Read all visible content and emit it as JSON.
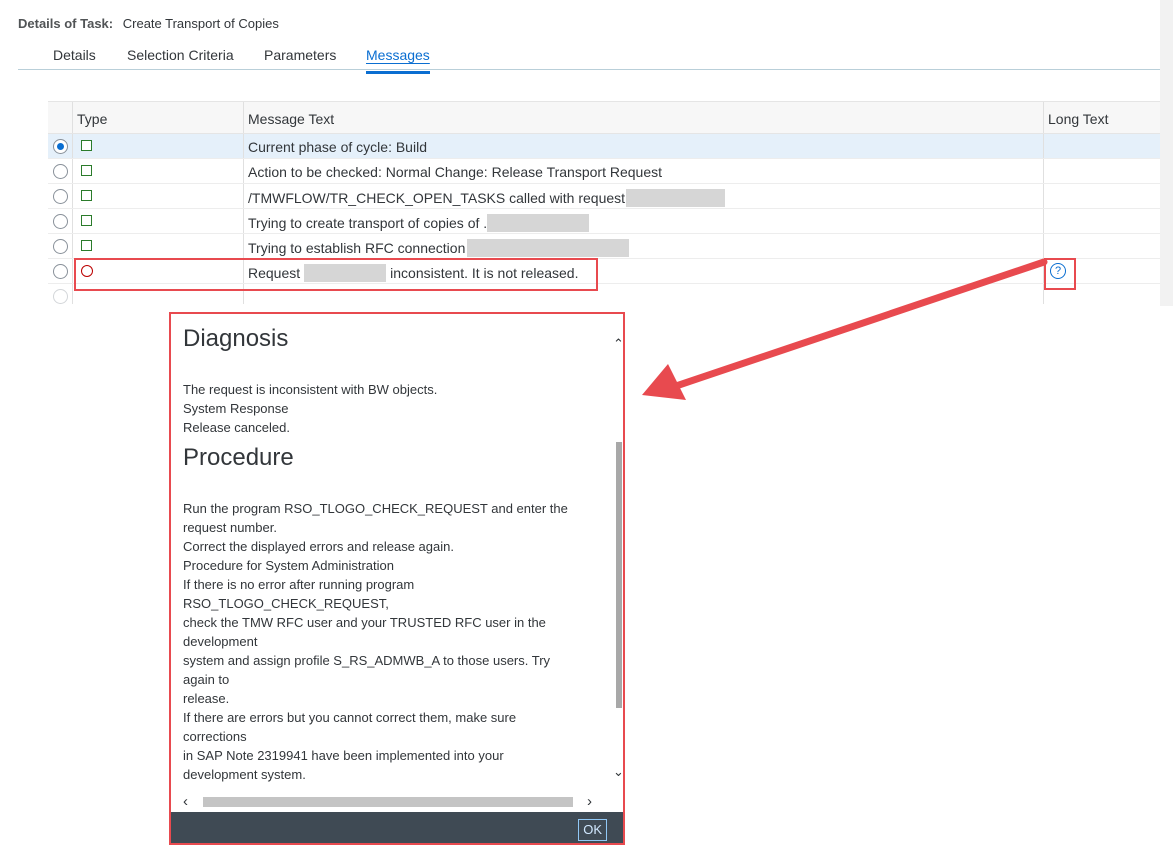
{
  "header": {
    "label": "Details of Task:",
    "value": "Create Transport of Copies"
  },
  "tabs": [
    {
      "label": "Details"
    },
    {
      "label": "Selection Criteria"
    },
    {
      "label": "Parameters"
    },
    {
      "label": "Messages"
    }
  ],
  "active_tab": "Messages",
  "table": {
    "columns": [
      "Type",
      "Message Text",
      "Long Text"
    ],
    "rows": [
      {
        "status": "success",
        "text": "Current phase of cycle: Build",
        "selected": true
      },
      {
        "status": "success",
        "text": "Action to be checked: Normal Change: Release Transport Request"
      },
      {
        "status": "success",
        "text": "/TMWFLOW/TR_CHECK_OPEN_TASKS called with request"
      },
      {
        "status": "success",
        "text": "Trying to create transport of copies of ."
      },
      {
        "status": "success",
        "text": "Trying to establish RFC connection"
      },
      {
        "status": "error",
        "text_before": "Request",
        "text_after": "inconsistent. It is not released.",
        "long_text_icon": "help-circle-icon"
      }
    ]
  },
  "popup": {
    "heading1": "Diagnosis",
    "diagnosis_lines": [
      "The request is inconsistent with BW objects.",
      "System Response",
      "Release canceled."
    ],
    "heading2": "Procedure",
    "procedure_lines": [
      "Run the program RSO_TLOGO_CHECK_REQUEST and enter the",
      "request number.",
      "Correct the displayed errors and release again.",
      "Procedure for System Administration",
      "If there is no error after running program",
      "RSO_TLOGO_CHECK_REQUEST,",
      "check the TMW RFC user and your TRUSTED RFC user in the",
      "development",
      "system and assign profile S_RS_ADMWB_A to those users. Try",
      "again to",
      "release.",
      "If there are errors but you cannot correct them, make sure",
      "corrections",
      "in SAP Note 2319941 have been implemented into your",
      "development system."
    ],
    "ok_label": "OK"
  },
  "colors": {
    "accent": "#0a6ed1",
    "highlight": "#e84a4f",
    "success": "#2b7c2b",
    "error": "#bb0000",
    "footer": "#3f4a54"
  }
}
